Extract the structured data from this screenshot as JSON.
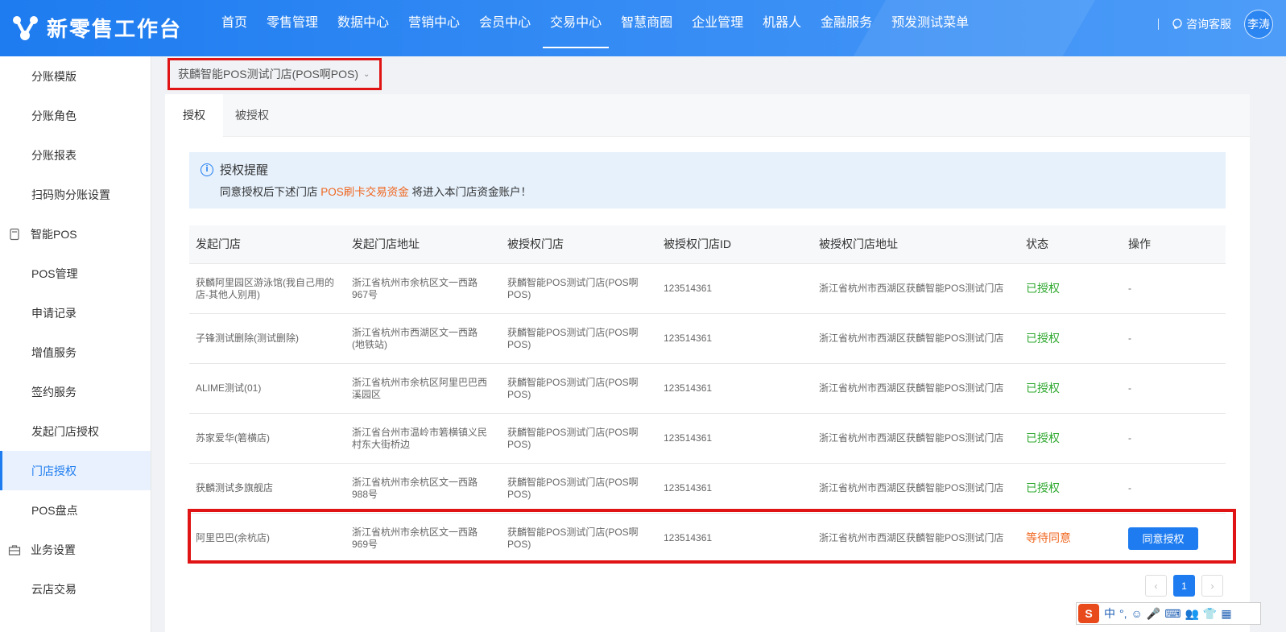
{
  "header": {
    "logo_text": "新零售工作台",
    "nav": [
      "首页",
      "零售管理",
      "数据中心",
      "营销中心",
      "会员中心",
      "交易中心",
      "智慧商圈",
      "企业管理",
      "机器人",
      "金融服务",
      "预发测试菜单"
    ],
    "active_nav": "交易中心",
    "service": "咨询客服",
    "avatar_name": "李涛"
  },
  "sidebar": {
    "items": [
      {
        "label": "分账模版",
        "type": "item"
      },
      {
        "label": "分账角色",
        "type": "item"
      },
      {
        "label": "分账报表",
        "type": "item"
      },
      {
        "label": "扫码购分账设置",
        "type": "item"
      },
      {
        "label": "智能POS",
        "type": "group",
        "icon": "pos-icon"
      },
      {
        "label": "POS管理",
        "type": "item"
      },
      {
        "label": "申请记录",
        "type": "item"
      },
      {
        "label": "增值服务",
        "type": "item"
      },
      {
        "label": "签约服务",
        "type": "item"
      },
      {
        "label": "发起门店授权",
        "type": "item"
      },
      {
        "label": "门店授权",
        "type": "item",
        "active": true
      },
      {
        "label": "POS盘点",
        "type": "item"
      },
      {
        "label": "业务设置",
        "type": "group",
        "icon": "briefcase-icon"
      },
      {
        "label": "云店交易",
        "type": "item"
      }
    ]
  },
  "store_selector": {
    "value": "获麟智能POS测试门店(POS啊POS)"
  },
  "tabs": [
    {
      "label": "授权",
      "active": true
    },
    {
      "label": "被授权",
      "active": false
    }
  ],
  "notice": {
    "title": "授权提醒",
    "text_before": "同意授权后下述门店 ",
    "highlight": "POS刷卡交易资金",
    "text_after": " 将进入本门店资金账户！"
  },
  "table": {
    "headers": [
      "发起门店",
      "发起门店地址",
      "被授权门店",
      "被授权门店ID",
      "被授权门店地址",
      "状态",
      "操作"
    ],
    "rows": [
      {
        "store": "获麟阿里园区游泳馆(我自己用的店-其他人别用)",
        "address": "浙江省杭州市余杭区文一西路967号",
        "auth_store": "获麟智能POS测试门店(POS啊POS)",
        "auth_id": "123514361",
        "auth_address": "浙江省杭州市西湖区获麟智能POS测试门店",
        "status": "已授权",
        "status_type": "ok",
        "action": "-"
      },
      {
        "store": "子锋测试删除(测试删除)",
        "address": "浙江省杭州市西湖区文一西路(地铁站)",
        "auth_store": "获麟智能POS测试门店(POS啊POS)",
        "auth_id": "123514361",
        "auth_address": "浙江省杭州市西湖区获麟智能POS测试门店",
        "status": "已授权",
        "status_type": "ok",
        "action": "-"
      },
      {
        "store": "ALIME测试(01)",
        "address": "浙江省杭州市余杭区阿里巴巴西溪园区",
        "auth_store": "获麟智能POS测试门店(POS啊POS)",
        "auth_id": "123514361",
        "auth_address": "浙江省杭州市西湖区获麟智能POS测试门店",
        "status": "已授权",
        "status_type": "ok",
        "action": "-"
      },
      {
        "store": "苏家爱华(箬横店)",
        "address": "浙江省台州市温岭市箬横镇义民村东大街桥边",
        "auth_store": "获麟智能POS测试门店(POS啊POS)",
        "auth_id": "123514361",
        "auth_address": "浙江省杭州市西湖区获麟智能POS测试门店",
        "status": "已授权",
        "status_type": "ok",
        "action": "-"
      },
      {
        "store": "获麟测试多旗舰店",
        "address": "浙江省杭州市余杭区文一西路988号",
        "auth_store": "获麟智能POS测试门店(POS啊POS)",
        "auth_id": "123514361",
        "auth_address": "浙江省杭州市西湖区获麟智能POS测试门店",
        "status": "已授权",
        "status_type": "ok",
        "action": "-"
      },
      {
        "store": "阿里巴巴(余杭店)",
        "address": "浙江省杭州市余杭区文一西路969号",
        "auth_store": "获麟智能POS测试门店(POS啊POS)",
        "auth_id": "123514361",
        "auth_address": "浙江省杭州市西湖区获麟智能POS测试门店",
        "status": "等待同意",
        "status_type": "wait",
        "action": "同意授权"
      }
    ]
  },
  "pagination": {
    "prev": "‹",
    "current": "1",
    "next": "›"
  },
  "ime_bar": {
    "logo": "S",
    "items": [
      "中",
      "°,",
      "☺",
      "🎤",
      "⌨",
      "👥",
      "👕",
      "▦"
    ]
  },
  "colors": {
    "primary": "#1e7cf0",
    "ok": "#2fa82f",
    "wait": "#f0661e",
    "highlight_box": "#e01414"
  }
}
